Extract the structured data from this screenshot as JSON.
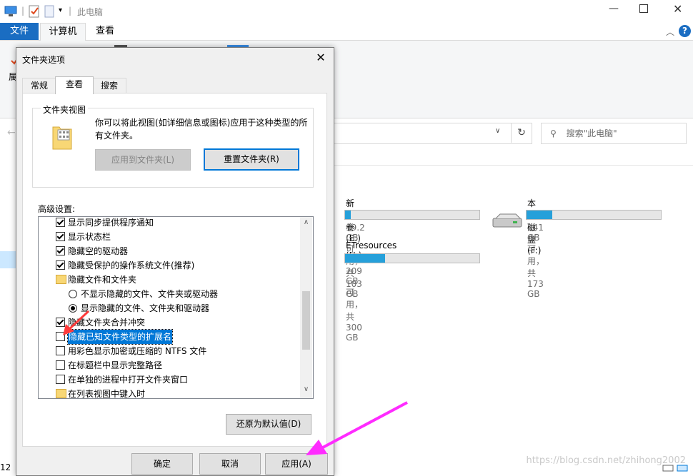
{
  "explorer": {
    "title": "此电脑",
    "ribbon_tabs": [
      "文件",
      "计算机",
      "查看"
    ],
    "search_placeholder": "搜索\"此电脑\"",
    "left_pane_num": "12",
    "drives": [
      {
        "name": "新加卷 (E:)",
        "info": "99.2 GB 可用，共 103 GB",
        "used_fraction": 0.04
      },
      {
        "name": "本地磁盘 (F:)",
        "info": "141 GB 可用，共 173 GB",
        "used_fraction": 0.19
      },
      {
        "name": "ETresources (H:)",
        "info": "209 GB 可用，共 300 GB",
        "used_fraction": 0.3
      }
    ],
    "ribbon_partial_char": "属",
    "watermark": "https://blog.csdn.net/zhihong2002"
  },
  "dialog": {
    "title": "文件夹选项",
    "tabs": [
      "常规",
      "查看",
      "搜索"
    ],
    "active_tab": "查看",
    "folder_view": {
      "legend": "文件夹视图",
      "description": "你可以将此视图(如详细信息或图标)应用于这种类型的所有文件夹。",
      "apply_button": "应用到文件夹(L)",
      "reset_button": "重置文件夹(R)"
    },
    "advanced_label": "高级设置:",
    "settings": [
      {
        "type": "checkbox",
        "checked": true,
        "label": "显示同步提供程序通知"
      },
      {
        "type": "checkbox",
        "checked": true,
        "label": "显示状态栏"
      },
      {
        "type": "checkbox",
        "checked": true,
        "label": "隐藏空的驱动器"
      },
      {
        "type": "checkbox",
        "checked": true,
        "label": "隐藏受保护的操作系统文件(推荐)"
      },
      {
        "type": "folder",
        "label": "隐藏文件和文件夹"
      },
      {
        "type": "radio",
        "checked": false,
        "label": "不显示隐藏的文件、文件夹或驱动器"
      },
      {
        "type": "radio",
        "checked": true,
        "label": "显示隐藏的文件、文件夹和驱动器"
      },
      {
        "type": "checkbox",
        "checked": true,
        "label": "隐藏文件夹合并冲突"
      },
      {
        "type": "checkbox",
        "checked": false,
        "label": "隐藏已知文件类型的扩展名",
        "selected": true
      },
      {
        "type": "checkbox",
        "checked": false,
        "label": "用彩色显示加密或压缩的 NTFS 文件"
      },
      {
        "type": "checkbox",
        "checked": false,
        "label": "在标题栏中显示完整路径"
      },
      {
        "type": "checkbox",
        "checked": false,
        "label": "在单独的进程中打开文件夹窗口"
      },
      {
        "type": "folder",
        "label": "在列表视图中键入时"
      }
    ],
    "restore_button": "还原为默认值(D)",
    "ok_button": "确定",
    "cancel_button": "取消",
    "apply_button": "应用(A)",
    "scroll_position": 0.42
  },
  "colors": {
    "accent": "#0078d7",
    "file_tab": "#1a6dc2",
    "drive_fill": "#26a0da",
    "annotation_arrow": "#ff2bff",
    "annotation_arrow_red": "#ff3b3b"
  }
}
